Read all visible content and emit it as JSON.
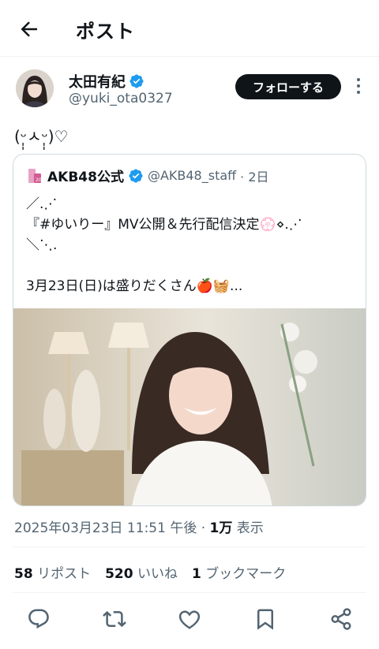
{
  "header": {
    "title": "ポスト",
    "back_icon": "arrow-left-icon"
  },
  "author": {
    "name": "太田有紀",
    "handle": "@yuki_ota0327",
    "verified": true,
    "follow_label": "フォローする",
    "more_icon": "more-vertical-icon"
  },
  "tweet": {
    "text": "(ᵕ̩̩ㅅᵕ̩̩)♡"
  },
  "quote": {
    "name": "AKB48公式",
    "handle": "@AKB48_staff",
    "time": "· 2日",
    "lines": [
      "／.⋰",
      "『#ゆいりー』MV公開＆先行配信決定💮⋄.⋰",
      "＼⋱.",
      "",
      "3月23日(日)は盛りだくさん🍎🧺..."
    ]
  },
  "meta": {
    "timestamp": "2025年03月23日 11:51 午後 · ",
    "views_count": "1万",
    "views_label": " 表示"
  },
  "stats": {
    "reposts_count": "58",
    "reposts_label": "リポスト",
    "likes_count": "520",
    "likes_label": "いいね",
    "bookmarks_count": "1",
    "bookmarks_label": "ブックマーク"
  },
  "actions": [
    "reply-icon",
    "repost-icon",
    "like-icon",
    "bookmark-icon",
    "share-icon"
  ],
  "colors": {
    "text": "#0f1419",
    "secondary": "#536471",
    "verified": "#1d9bf0",
    "border": "#cfd9de"
  }
}
